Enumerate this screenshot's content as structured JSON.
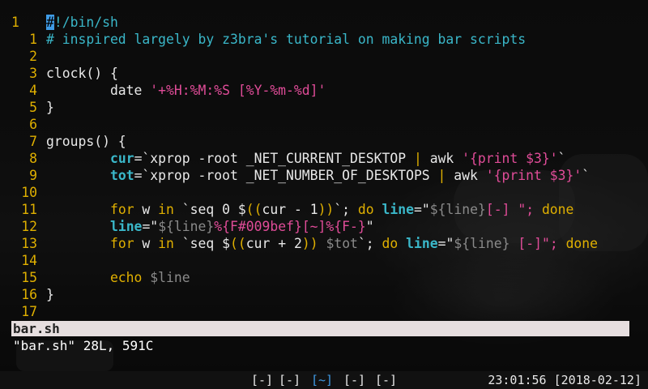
{
  "editor": {
    "lines": [
      {
        "n": "1",
        "abs": true,
        "segments": [
          {
            "t": "#",
            "cls": "cursor"
          },
          {
            "t": "!/bin/sh",
            "cls": "c-comment"
          }
        ]
      },
      {
        "n": "1",
        "abs": false,
        "segments": [
          {
            "t": "# inspired largely by z3bra's tutorial on making bar scripts",
            "cls": "c-comment"
          }
        ]
      },
      {
        "n": "2",
        "abs": false,
        "segments": []
      },
      {
        "n": "3",
        "abs": false,
        "segments": [
          {
            "t": "clock() {",
            "cls": ""
          }
        ]
      },
      {
        "n": "4",
        "abs": false,
        "segments": [
          {
            "t": "        date ",
            "cls": ""
          },
          {
            "t": "'+%H:%M:%S [%Y-%m-%d]'",
            "cls": "c-string"
          }
        ]
      },
      {
        "n": "5",
        "abs": false,
        "segments": [
          {
            "t": "}",
            "cls": ""
          }
        ]
      },
      {
        "n": "6",
        "abs": false,
        "segments": []
      },
      {
        "n": "7",
        "abs": false,
        "segments": [
          {
            "t": "groups() {",
            "cls": ""
          }
        ]
      },
      {
        "n": "8",
        "abs": false,
        "segments": [
          {
            "t": "        ",
            "cls": ""
          },
          {
            "t": "cur",
            "cls": "c-var"
          },
          {
            "t": "=`xprop -root _NET_CURRENT_DESKTOP ",
            "cls": ""
          },
          {
            "t": "|",
            "cls": "c-op"
          },
          {
            "t": " awk ",
            "cls": ""
          },
          {
            "t": "'{print $3}'",
            "cls": "c-string"
          },
          {
            "t": "`",
            "cls": ""
          }
        ]
      },
      {
        "n": "9",
        "abs": false,
        "segments": [
          {
            "t": "        ",
            "cls": ""
          },
          {
            "t": "tot",
            "cls": "c-var"
          },
          {
            "t": "=`xprop -root _NET_NUMBER_OF_DESKTOPS ",
            "cls": ""
          },
          {
            "t": "|",
            "cls": "c-op"
          },
          {
            "t": " awk ",
            "cls": ""
          },
          {
            "t": "'{print $3}'",
            "cls": "c-string"
          },
          {
            "t": "`",
            "cls": ""
          }
        ]
      },
      {
        "n": "10",
        "abs": false,
        "segments": []
      },
      {
        "n": "11",
        "abs": false,
        "segments": [
          {
            "t": "        ",
            "cls": ""
          },
          {
            "t": "for",
            "cls": "c-kw"
          },
          {
            "t": " w ",
            "cls": ""
          },
          {
            "t": "in",
            "cls": "c-kw"
          },
          {
            "t": " `seq 0 $",
            "cls": ""
          },
          {
            "t": "((",
            "cls": "c-op"
          },
          {
            "t": "cur - 1",
            "cls": ""
          },
          {
            "t": "))",
            "cls": "c-op"
          },
          {
            "t": "`; ",
            "cls": ""
          },
          {
            "t": "do",
            "cls": "c-kw"
          },
          {
            "t": " ",
            "cls": ""
          },
          {
            "t": "line",
            "cls": "c-var"
          },
          {
            "t": "=\"",
            "cls": ""
          },
          {
            "t": "${line}",
            "cls": "c-dim"
          },
          {
            "t": "[-] \"; ",
            "cls": "c-string"
          },
          {
            "t": "done",
            "cls": "c-kw"
          }
        ]
      },
      {
        "n": "12",
        "abs": false,
        "segments": [
          {
            "t": "        ",
            "cls": ""
          },
          {
            "t": "line",
            "cls": "c-var"
          },
          {
            "t": "=\"",
            "cls": ""
          },
          {
            "t": "${line}",
            "cls": "c-dim"
          },
          {
            "t": "%{F#009bef}[~]%{F-}",
            "cls": "c-string"
          },
          {
            "t": "\"",
            "cls": ""
          }
        ]
      },
      {
        "n": "13",
        "abs": false,
        "segments": [
          {
            "t": "        ",
            "cls": ""
          },
          {
            "t": "for",
            "cls": "c-kw"
          },
          {
            "t": " w ",
            "cls": ""
          },
          {
            "t": "in",
            "cls": "c-kw"
          },
          {
            "t": " `seq $",
            "cls": ""
          },
          {
            "t": "((",
            "cls": "c-op"
          },
          {
            "t": "cur + 2",
            "cls": ""
          },
          {
            "t": "))",
            "cls": "c-op"
          },
          {
            "t": " ",
            "cls": ""
          },
          {
            "t": "$tot",
            "cls": "c-dim"
          },
          {
            "t": "`; ",
            "cls": ""
          },
          {
            "t": "do",
            "cls": "c-kw"
          },
          {
            "t": " ",
            "cls": ""
          },
          {
            "t": "line",
            "cls": "c-var"
          },
          {
            "t": "=\"",
            "cls": ""
          },
          {
            "t": "${line}",
            "cls": "c-dim"
          },
          {
            "t": " [-]\"; ",
            "cls": "c-string"
          },
          {
            "t": "done",
            "cls": "c-kw"
          }
        ]
      },
      {
        "n": "14",
        "abs": false,
        "segments": []
      },
      {
        "n": "15",
        "abs": false,
        "segments": [
          {
            "t": "        echo ",
            "cls": "c-kw"
          },
          {
            "t": "$line",
            "cls": "c-dim"
          }
        ]
      },
      {
        "n": "16",
        "abs": false,
        "segments": [
          {
            "t": "}",
            "cls": ""
          }
        ]
      },
      {
        "n": "17",
        "abs": false,
        "segments": []
      }
    ],
    "status_filename": "bar.sh",
    "message": "\"bar.sh\" 28L, 591C"
  },
  "panel": {
    "workspaces": [
      {
        "label": "[-]",
        "active": false
      },
      {
        "label": "[-]",
        "active": false
      },
      {
        "label": "[~]",
        "active": true
      },
      {
        "label": "[-]",
        "active": false
      },
      {
        "label": "[-]",
        "active": false
      }
    ],
    "clock": "23:01:56 [2018-02-12]"
  },
  "colors": {
    "line_number": "#e0b000",
    "comment": "#3ab7c9",
    "string": "#e04c98",
    "active_workspace": "#3f9be6",
    "statusline_bg": "#e6dedf"
  }
}
